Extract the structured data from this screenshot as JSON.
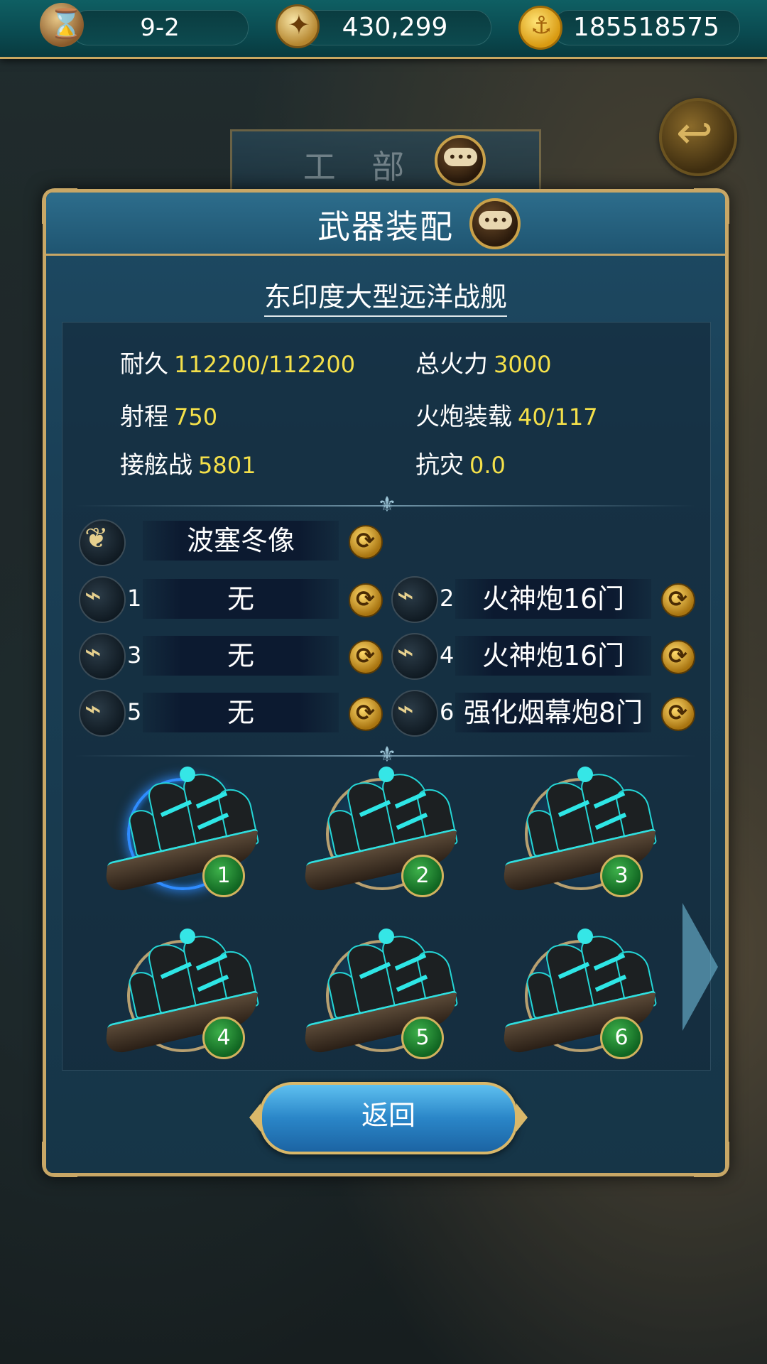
{
  "topbar": {
    "stage": "9-2",
    "compass_value": "430,299",
    "gold_value": "185518575"
  },
  "bg_tab": {
    "label": "工 部"
  },
  "panel": {
    "title": "武器装配",
    "ship_name": "东印度大型远洋战舰",
    "return_label": "返回"
  },
  "stats": {
    "durability": {
      "label": "耐久",
      "value": "112200/112200"
    },
    "firepower": {
      "label": "总火力",
      "value": "3000"
    },
    "range": {
      "label": "射程",
      "value": "750"
    },
    "cannon_load": {
      "label": "火炮装载",
      "value": "40/117"
    },
    "boarding": {
      "label": "接舷战",
      "value": "5801"
    },
    "disaster_res": {
      "label": "抗灾",
      "value": "0.0"
    }
  },
  "figurehead": {
    "value": "波塞冬像"
  },
  "slots": [
    {
      "num": "1",
      "value": "无"
    },
    {
      "num": "2",
      "value": "火神炮16门"
    },
    {
      "num": "3",
      "value": "无"
    },
    {
      "num": "4",
      "value": "火神炮16门"
    },
    {
      "num": "5",
      "value": "无"
    },
    {
      "num": "6",
      "value": "强化烟幕炮8门"
    }
  ],
  "ships": [
    {
      "num": "1",
      "selected": true
    },
    {
      "num": "2",
      "selected": false
    },
    {
      "num": "3",
      "selected": false
    },
    {
      "num": "4",
      "selected": false
    },
    {
      "num": "5",
      "selected": false
    },
    {
      "num": "6",
      "selected": false
    }
  ],
  "icons": {
    "stage": "hourglass-icon",
    "compass": "compass-icon",
    "gold": "anchor-coin-icon",
    "back": "back-arrow-icon",
    "chat": "chat-bubble-icon",
    "figurehead": "wing-icon",
    "cannon": "cannon-icon",
    "swap": "swap-icon"
  },
  "colors": {
    "stat_value": "#f4e04a",
    "panel_border": "#c8a766",
    "selected_ring": "#2f8cff"
  }
}
